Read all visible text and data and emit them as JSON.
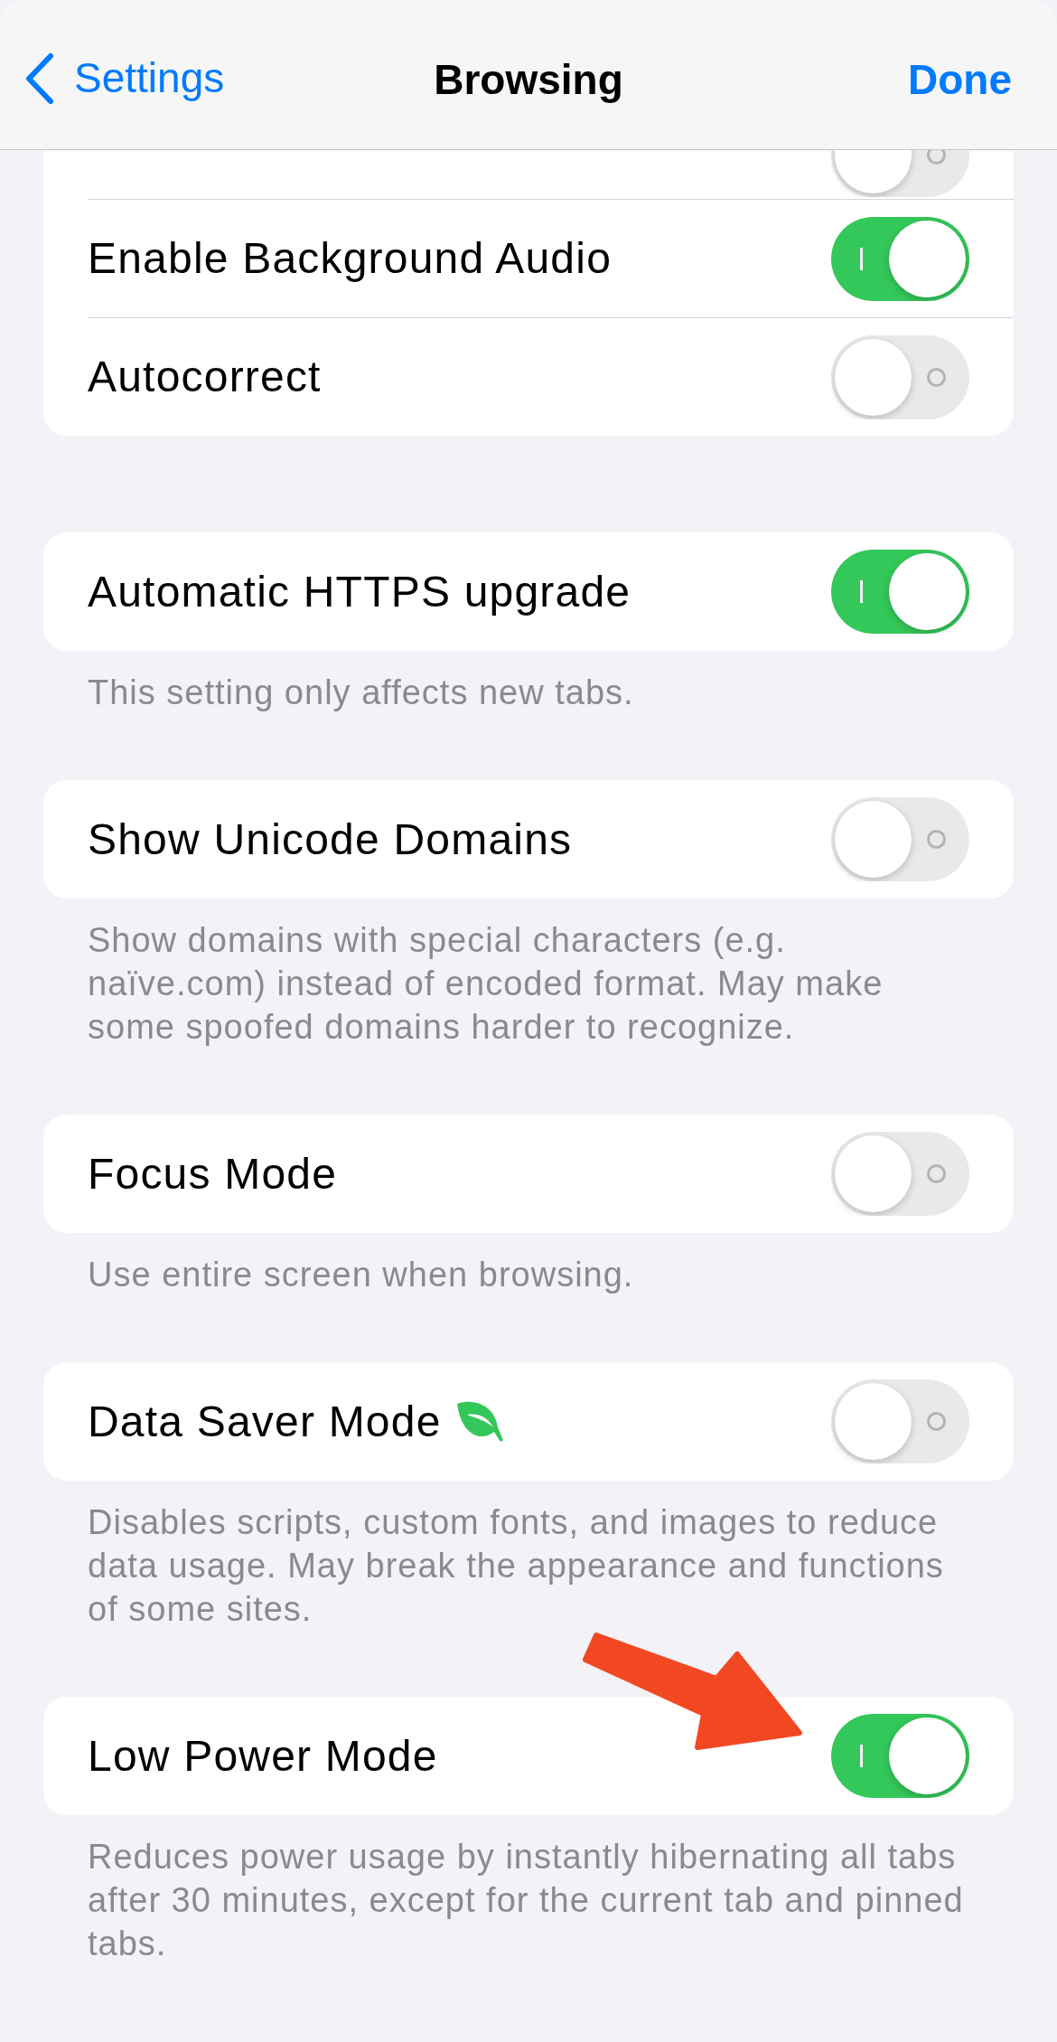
{
  "nav": {
    "back": "Settings",
    "title": "Browsing",
    "done": "Done"
  },
  "groups": [
    {
      "rows": [
        {
          "on": false
        },
        {
          "label": "Enable Background Audio",
          "on": true
        },
        {
          "label": "Autocorrect",
          "on": false
        }
      ]
    },
    {
      "rows": [
        {
          "label": "Automatic HTTPS upgrade",
          "on": true
        }
      ],
      "footer": "This setting only affects new tabs."
    },
    {
      "rows": [
        {
          "label": "Show Unicode Domains",
          "on": false
        }
      ],
      "footer": "Show domains with special characters (e.g. naïve.com) instead of encoded format. May make some spoofed domains harder to recognize."
    },
    {
      "rows": [
        {
          "label": "Focus Mode",
          "on": false
        }
      ],
      "footer": "Use entire screen when browsing."
    },
    {
      "rows": [
        {
          "label": "Data Saver Mode",
          "on": false,
          "leaf": true
        }
      ],
      "footer": "Disables scripts, custom fonts, and images to reduce data usage. May break the appearance and functions of some sites."
    },
    {
      "rows": [
        {
          "label": "Low Power Mode",
          "on": true,
          "pointer": true
        }
      ],
      "footer": "Reduces power usage by instantly hibernating all tabs after 30 minutes, except for the current tab and pinned tabs."
    }
  ]
}
